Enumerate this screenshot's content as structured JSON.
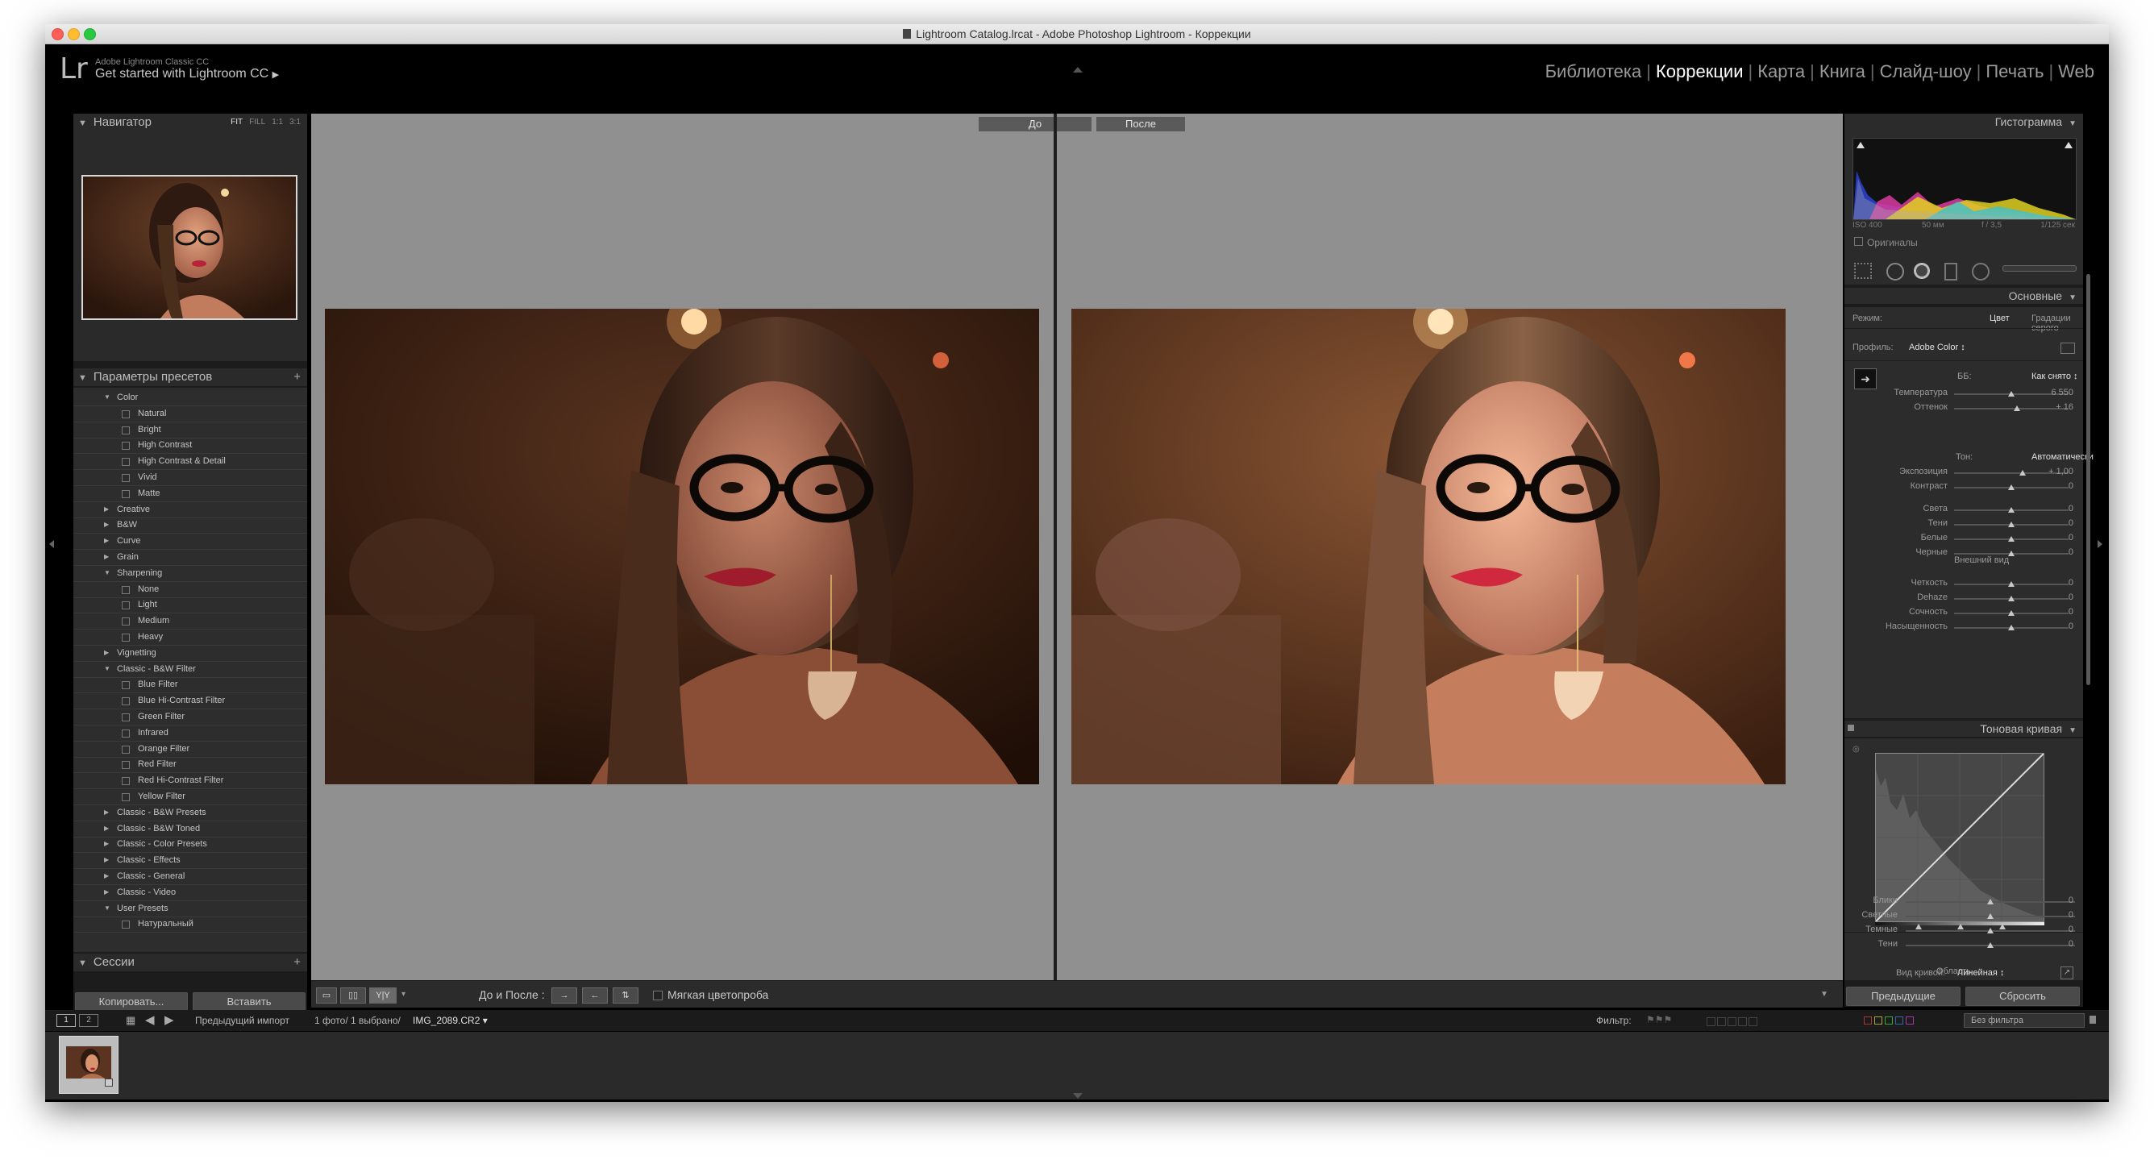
{
  "window": {
    "title": "Lightroom Catalog.lrcat - Adobe Photoshop Lightroom - Коррекции"
  },
  "identity": {
    "logo": "Lr",
    "product": "Adobe Lightroom Classic CC",
    "tagline": "Get started with Lightroom CC"
  },
  "modules": [
    {
      "label": "Библиотека",
      "active": false
    },
    {
      "label": "Коррекции",
      "active": true
    },
    {
      "label": "Карта",
      "active": false
    },
    {
      "label": "Книга",
      "active": false
    },
    {
      "label": "Слайд-шоу",
      "active": false
    },
    {
      "label": "Печать",
      "active": false
    },
    {
      "label": "Web",
      "active": false
    }
  ],
  "navigator": {
    "title": "Навигатор",
    "options": [
      "FIT",
      "FILL",
      "1:1",
      "3:1"
    ]
  },
  "presets": {
    "title": "Параметры пресетов",
    "items": [
      {
        "label": "Color",
        "level": 0,
        "expanded": true
      },
      {
        "label": "Natural",
        "level": 1
      },
      {
        "label": "Bright",
        "level": 1
      },
      {
        "label": "High Contrast",
        "level": 1
      },
      {
        "label": "High Contrast & Detail",
        "level": 1
      },
      {
        "label": "Vivid",
        "level": 1
      },
      {
        "label": "Matte",
        "level": 1
      },
      {
        "label": "Creative",
        "level": 0,
        "expanded": false
      },
      {
        "label": "B&W",
        "level": 0,
        "expanded": false
      },
      {
        "label": "Curve",
        "level": 0,
        "expanded": false
      },
      {
        "label": "Grain",
        "level": 0,
        "expanded": false
      },
      {
        "label": "Sharpening",
        "level": 0,
        "expanded": true
      },
      {
        "label": "None",
        "level": 1
      },
      {
        "label": "Light",
        "level": 1
      },
      {
        "label": "Medium",
        "level": 1
      },
      {
        "label": "Heavy",
        "level": 1
      },
      {
        "label": "Vignetting",
        "level": 0,
        "expanded": false
      },
      {
        "label": "Classic - B&W Filter",
        "level": 0,
        "expanded": true
      },
      {
        "label": "Blue Filter",
        "level": 1
      },
      {
        "label": "Blue Hi-Contrast Filter",
        "level": 1
      },
      {
        "label": "Green Filter",
        "level": 1
      },
      {
        "label": "Infrared",
        "level": 1
      },
      {
        "label": "Orange Filter",
        "level": 1
      },
      {
        "label": "Red Filter",
        "level": 1
      },
      {
        "label": "Red Hi-Contrast Filter",
        "level": 1
      },
      {
        "label": "Yellow Filter",
        "level": 1
      },
      {
        "label": "Classic - B&W Presets",
        "level": 0,
        "expanded": false
      },
      {
        "label": "Classic - B&W Toned",
        "level": 0,
        "expanded": false
      },
      {
        "label": "Classic - Color Presets",
        "level": 0,
        "expanded": false
      },
      {
        "label": "Classic - Effects",
        "level": 0,
        "expanded": false
      },
      {
        "label": "Classic - General",
        "level": 0,
        "expanded": false
      },
      {
        "label": "Classic - Video",
        "level": 0,
        "expanded": false
      },
      {
        "label": "User Presets",
        "level": 0,
        "expanded": true
      },
      {
        "label": "Натуральный",
        "level": 1
      }
    ]
  },
  "sessions": {
    "title": "Сессии"
  },
  "left_buttons": {
    "copy": "Копировать...",
    "paste": "Вставить"
  },
  "compare": {
    "before": "До",
    "after": "После"
  },
  "toolbar": {
    "before_after_label": "До и После :",
    "soft_proof_label": "Мягкая цветопроба",
    "view_mode": "Y|Y"
  },
  "histogram": {
    "title": "Гистограмма",
    "iso": "ISO 400",
    "focal": "50 мм",
    "aperture": "f / 3,5",
    "shutter": "1/125 сек",
    "originals_label": "Оригиналы"
  },
  "basic": {
    "title": "Основные",
    "mode_label": "Режим:",
    "mode_color": "Цвет",
    "mode_gray": "Градации серого",
    "profile_label": "Профиль:",
    "profile_value": "Adobe Color",
    "wb_label": "ББ:",
    "wb_value": "Как снято",
    "temp": {
      "label": "Температура",
      "value": "6 550",
      "pos": 0.5
    },
    "tint": {
      "label": "Оттенок",
      "value": "+ 16",
      "pos": 0.55
    },
    "tone_label": "Тон:",
    "tone_auto": "Автоматически",
    "exposure": {
      "label": "Экспозиция",
      "value": "+ 1,00",
      "pos": 0.6
    },
    "contrast": {
      "label": "Контраст",
      "value": "0",
      "pos": 0.5
    },
    "highlights": {
      "label": "Света",
      "value": "0",
      "pos": 0.5
    },
    "shadows": {
      "label": "Тени",
      "value": "0",
      "pos": 0.5
    },
    "whites": {
      "label": "Белые",
      "value": "0",
      "pos": 0.5
    },
    "blacks": {
      "label": "Черные",
      "value": "0",
      "pos": 0.5
    },
    "presence_label": "Внешний вид",
    "clarity": {
      "label": "Четкость",
      "value": "0",
      "pos": 0.5
    },
    "dehaze": {
      "label": "Dehaze",
      "value": "0",
      "pos": 0.5
    },
    "vibrance": {
      "label": "Сочность",
      "value": "0",
      "pos": 0.5
    },
    "saturation": {
      "label": "Насыщенность",
      "value": "0",
      "pos": 0.5
    }
  },
  "tone_curve": {
    "title": "Тоновая кривая",
    "region_label": "Область",
    "highlights": {
      "label": "Блики",
      "value": "0",
      "pos": 0.5
    },
    "lights": {
      "label": "Светлые",
      "value": "0",
      "pos": 0.5
    },
    "darks": {
      "label": "Темные",
      "value": "0",
      "pos": 0.5
    },
    "shadows": {
      "label": "Тени",
      "value": "0",
      "pos": 0.5
    },
    "curve_label": "Вид кривой:",
    "curve_value": "Линейная"
  },
  "right_buttons": {
    "previous": "Предыдущие",
    "reset": "Сбросить"
  },
  "filmbar": {
    "page1": "1",
    "page2": "2",
    "source": "Предыдущий импорт",
    "count": "1 фото/ 1 выбрано/",
    "filename": "IMG_2089.CR2",
    "filter_label": "Фильтр:",
    "filter_value": "Без фильтра"
  },
  "colors": {
    "accent_active": "#ffffff",
    "panel_bg": "#2c2c2c",
    "canvas_bg": "#909090"
  }
}
